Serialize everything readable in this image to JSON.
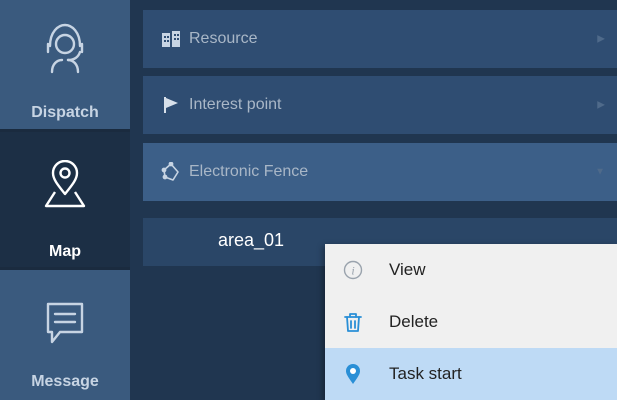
{
  "rail": {
    "items": [
      {
        "label": "Dispatch",
        "icon": "headset-person-icon"
      },
      {
        "label": "Map",
        "icon": "map-pin-icon",
        "active": true
      },
      {
        "label": "Message",
        "icon": "chat-message-icon"
      }
    ]
  },
  "panel": {
    "rows": [
      {
        "label": "Resource",
        "icon": "building-icon"
      },
      {
        "label": "Interest point",
        "icon": "flag-icon"
      },
      {
        "label": "Electronic Fence",
        "icon": "fence-icon",
        "expanded": true
      }
    ],
    "fence_items": [
      {
        "label": "area_01"
      }
    ]
  },
  "context_menu": {
    "items": [
      {
        "label": "View",
        "icon": "info-icon"
      },
      {
        "label": "Delete",
        "icon": "delete-icon"
      },
      {
        "label": "Task start",
        "icon": "location-pin-icon",
        "highlighted": true
      }
    ]
  },
  "colors": {
    "rail_bg": "#3a5a7e",
    "rail_active": "#1c2f45",
    "row_bg": "#2f4d72",
    "row_active": "#3c5f88",
    "menu_highlight": "#bedaf5",
    "accent": "#2a8fd6"
  }
}
